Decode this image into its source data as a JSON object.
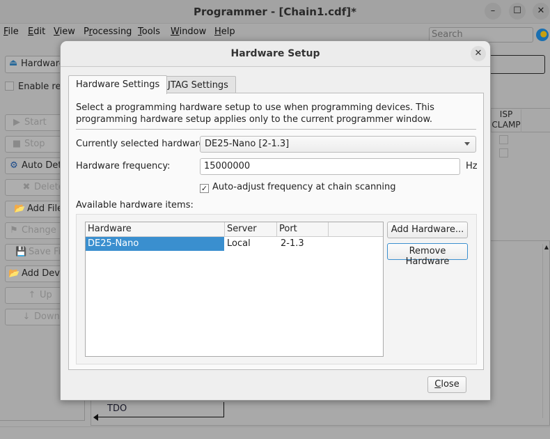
{
  "window": {
    "title": "Programmer - [Chain1.cdf]*",
    "minimize": "–",
    "maximize": "☐",
    "close": "✕"
  },
  "menu": [
    {
      "key": "F",
      "rest": "ile"
    },
    {
      "key": "E",
      "rest": "dit"
    },
    {
      "key": "V",
      "rest": "iew"
    },
    {
      "pre": "P",
      "key": "r",
      "rest": "ocessing"
    },
    {
      "key": "T",
      "rest": "ools"
    },
    {
      "key": "W",
      "rest": "indow"
    },
    {
      "key": "H",
      "rest": "elp"
    }
  ],
  "search": {
    "placeholder": "Search"
  },
  "toolbar": {
    "hardware_button": "Hardware",
    "enable_label": "Enable rea"
  },
  "left_buttons": [
    {
      "label": "Start",
      "icon": "▶"
    },
    {
      "label": "Stop",
      "icon": "■"
    },
    {
      "label": "Auto Dete",
      "icon": "⚙"
    },
    {
      "label": "Delete",
      "icon": "✖"
    },
    {
      "label": "Add File",
      "icon": "📂"
    },
    {
      "label": "Change Fi",
      "icon": "⚑"
    },
    {
      "label": "Save Fil",
      "icon": "💾"
    },
    {
      "label": "Add Devic",
      "icon": "📂"
    },
    {
      "label": "Up",
      "icon": "↑"
    },
    {
      "label": "Down",
      "icon": "↓"
    }
  ],
  "device_table": {
    "col_isp_clamp": [
      "ISP",
      "CLAMP"
    ]
  },
  "chain": {
    "tdo": "TDO"
  },
  "dialog": {
    "title": "Hardware Setup",
    "close": "✕",
    "tabs": [
      "Hardware Settings",
      "JTAG Settings"
    ],
    "description": "Select a programming hardware setup to use when programming devices. This programming hardware setup applies only to the current programmer window.",
    "selected_label": "Currently selected hardware:",
    "selected_value": "DE25-Nano [2-1.3]",
    "freq_label": "Hardware frequency:",
    "freq_value": "15000000",
    "freq_unit": "Hz",
    "auto_adjust": "Auto-adjust frequency at chain scanning",
    "auto_adjust_checked": "✓",
    "available_label": "Available hardware items:",
    "columns": [
      "Hardware",
      "Server",
      "Port"
    ],
    "rows": [
      {
        "hardware": "DE25-Nano",
        "server": "Local",
        "port": "2-1.3"
      }
    ],
    "add_button": "Add Hardware...",
    "remove_button": "Remove Hardware",
    "close_button_key": "C",
    "close_button_rest": "lose"
  }
}
